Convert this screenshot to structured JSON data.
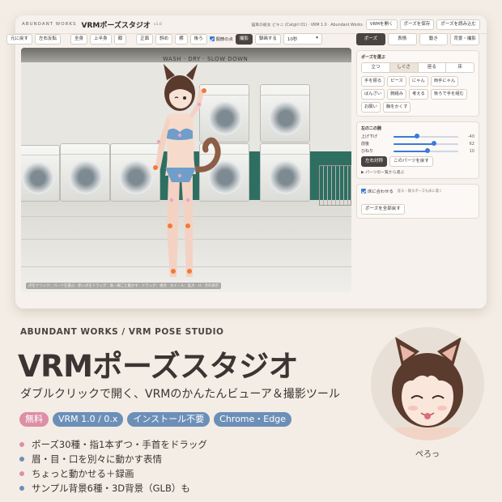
{
  "window": {
    "brand": "ABUNDANT WORKS",
    "title": "VRMポーズスタジオ",
    "version": "v1.0",
    "model_info": "猫耳の彼女 ビキニ (Catgirl 01) · VRM 1.0 · Abundant Works",
    "header_buttons": [
      "VRMを開く",
      "ポーズを保存",
      "ポーズを読み込む"
    ]
  },
  "toolbar": {
    "undo": "元に戻す",
    "mirror": "左右反転",
    "camera": [
      "全身",
      "上半身",
      "顔"
    ],
    "angles": [
      "正面",
      "斜め",
      "横",
      "後ろ"
    ],
    "joint_checkbox": "関節の点",
    "capture": "撮影",
    "record": "録画する",
    "duration": "10秒"
  },
  "viewport": {
    "sign": "WASH · DRY · SLOW DOWN",
    "hint": "点をクリック：パーツを選ぶ · 赤い点をドラッグ：肩・脚ごと動かす · ドラッグ：視点 · ホイール：拡大 · H：点の表示"
  },
  "side": {
    "tabs": [
      "ポーズ",
      "表情",
      "動き",
      "背景・撮影"
    ],
    "pose_title": "ポーズを選ぶ",
    "categories": [
      "立つ",
      "しぐさ",
      "座る",
      "床"
    ],
    "active_category": "しぐさ",
    "poses": [
      "手を振る",
      "ピース",
      "にゃん",
      "両手にゃん",
      "ばんざい",
      "腕組み",
      "考える",
      "後ろで手を組む",
      "お願い",
      "胸をかくす"
    ],
    "arm_title": "左の二の腕",
    "sliders": [
      {
        "label": "上げ下げ",
        "value": -40,
        "fraction": 0.36
      },
      {
        "label": "前後",
        "value": 62,
        "fraction": 0.62
      },
      {
        "label": "ひねり",
        "value": 10,
        "fraction": 0.53
      }
    ],
    "mirror_btn": "左右対称",
    "reset_part_btn": "このパーツを戻す",
    "parts_list": "▶ パーツの一覧から選ぶ",
    "floor_checkbox": "床に合わせる",
    "floor_note": "座る・寝るポーズも床に着く",
    "reset_all": "ポーズを全部戻す"
  },
  "promo": {
    "crumb": "ABUNDANT WORKS  /  VRM POSE STUDIO",
    "headline": "VRMポーズスタジオ",
    "subline": "ダブルクリックで開く、VRMのかんたんビューア＆撮影ツール",
    "pills": [
      {
        "text": "無料",
        "color": "#dd8fa7"
      },
      {
        "text": "VRM 1.0 / 0.x",
        "color": "#6c8fb8"
      },
      {
        "text": "インストール不要",
        "color": "#6c8fb8"
      },
      {
        "text": "Chrome・Edge",
        "color": "#6c8fb8"
      }
    ],
    "features": [
      {
        "text": "ポーズ30種・指1本ずつ・手首をドラッグ",
        "color": "#dd8fa7"
      },
      {
        "text": "眉・目・口を別々に動かす表情",
        "color": "#6c8fb8"
      },
      {
        "text": "ちょっと動かせる＋録画",
        "color": "#dd8fa7"
      },
      {
        "text": "サンプル背景6種・3D背景（GLB）も",
        "color": "#6c8fb8"
      }
    ],
    "caption": "ぺろっ"
  }
}
